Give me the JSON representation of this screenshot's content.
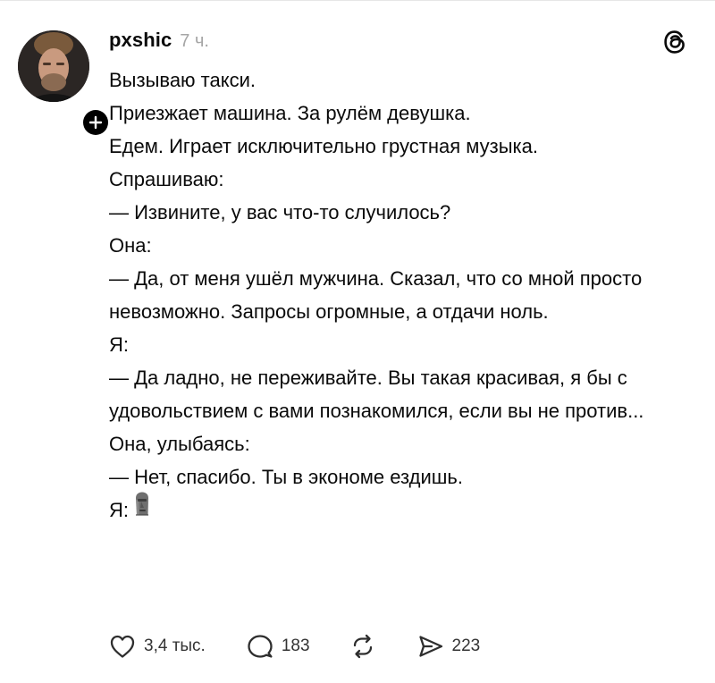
{
  "post": {
    "username": "pxshic",
    "timestamp": "7 ч.",
    "lines": [
      "Вызываю такси.",
      "Приезжает машина. За рулём девушка.",
      "Едем. Играет исключительно грустная музыка.",
      "Спрашиваю:",
      "— Извините, у вас что-то случилось?",
      "Она:",
      "— Да, от меня ушёл мужчина. Сказал, что со мной просто невозможно. Запросы огромные, а отдачи ноль.",
      "Я:",
      "— Да ладно, не переживайте. Вы такая красивая, я бы с удовольствием с вами познакомился, если вы не против...",
      "Она, улыбаясь:",
      "— Нет, спасибо. Ты в экономе ездишь.",
      "Я:"
    ],
    "last_line_emoji": "moai-icon"
  },
  "actions": {
    "likes": "3,4 тыс.",
    "replies": "183",
    "shares": "223"
  },
  "icons": {
    "brand": "threads-logo-icon",
    "like": "heart-icon",
    "reply": "comment-bubble-icon",
    "repost": "repost-icon",
    "send": "send-icon",
    "follow": "plus-icon"
  },
  "colors": {
    "text": "#0a0a0a",
    "muted": "#a6a6a6",
    "icon": "#333333"
  }
}
